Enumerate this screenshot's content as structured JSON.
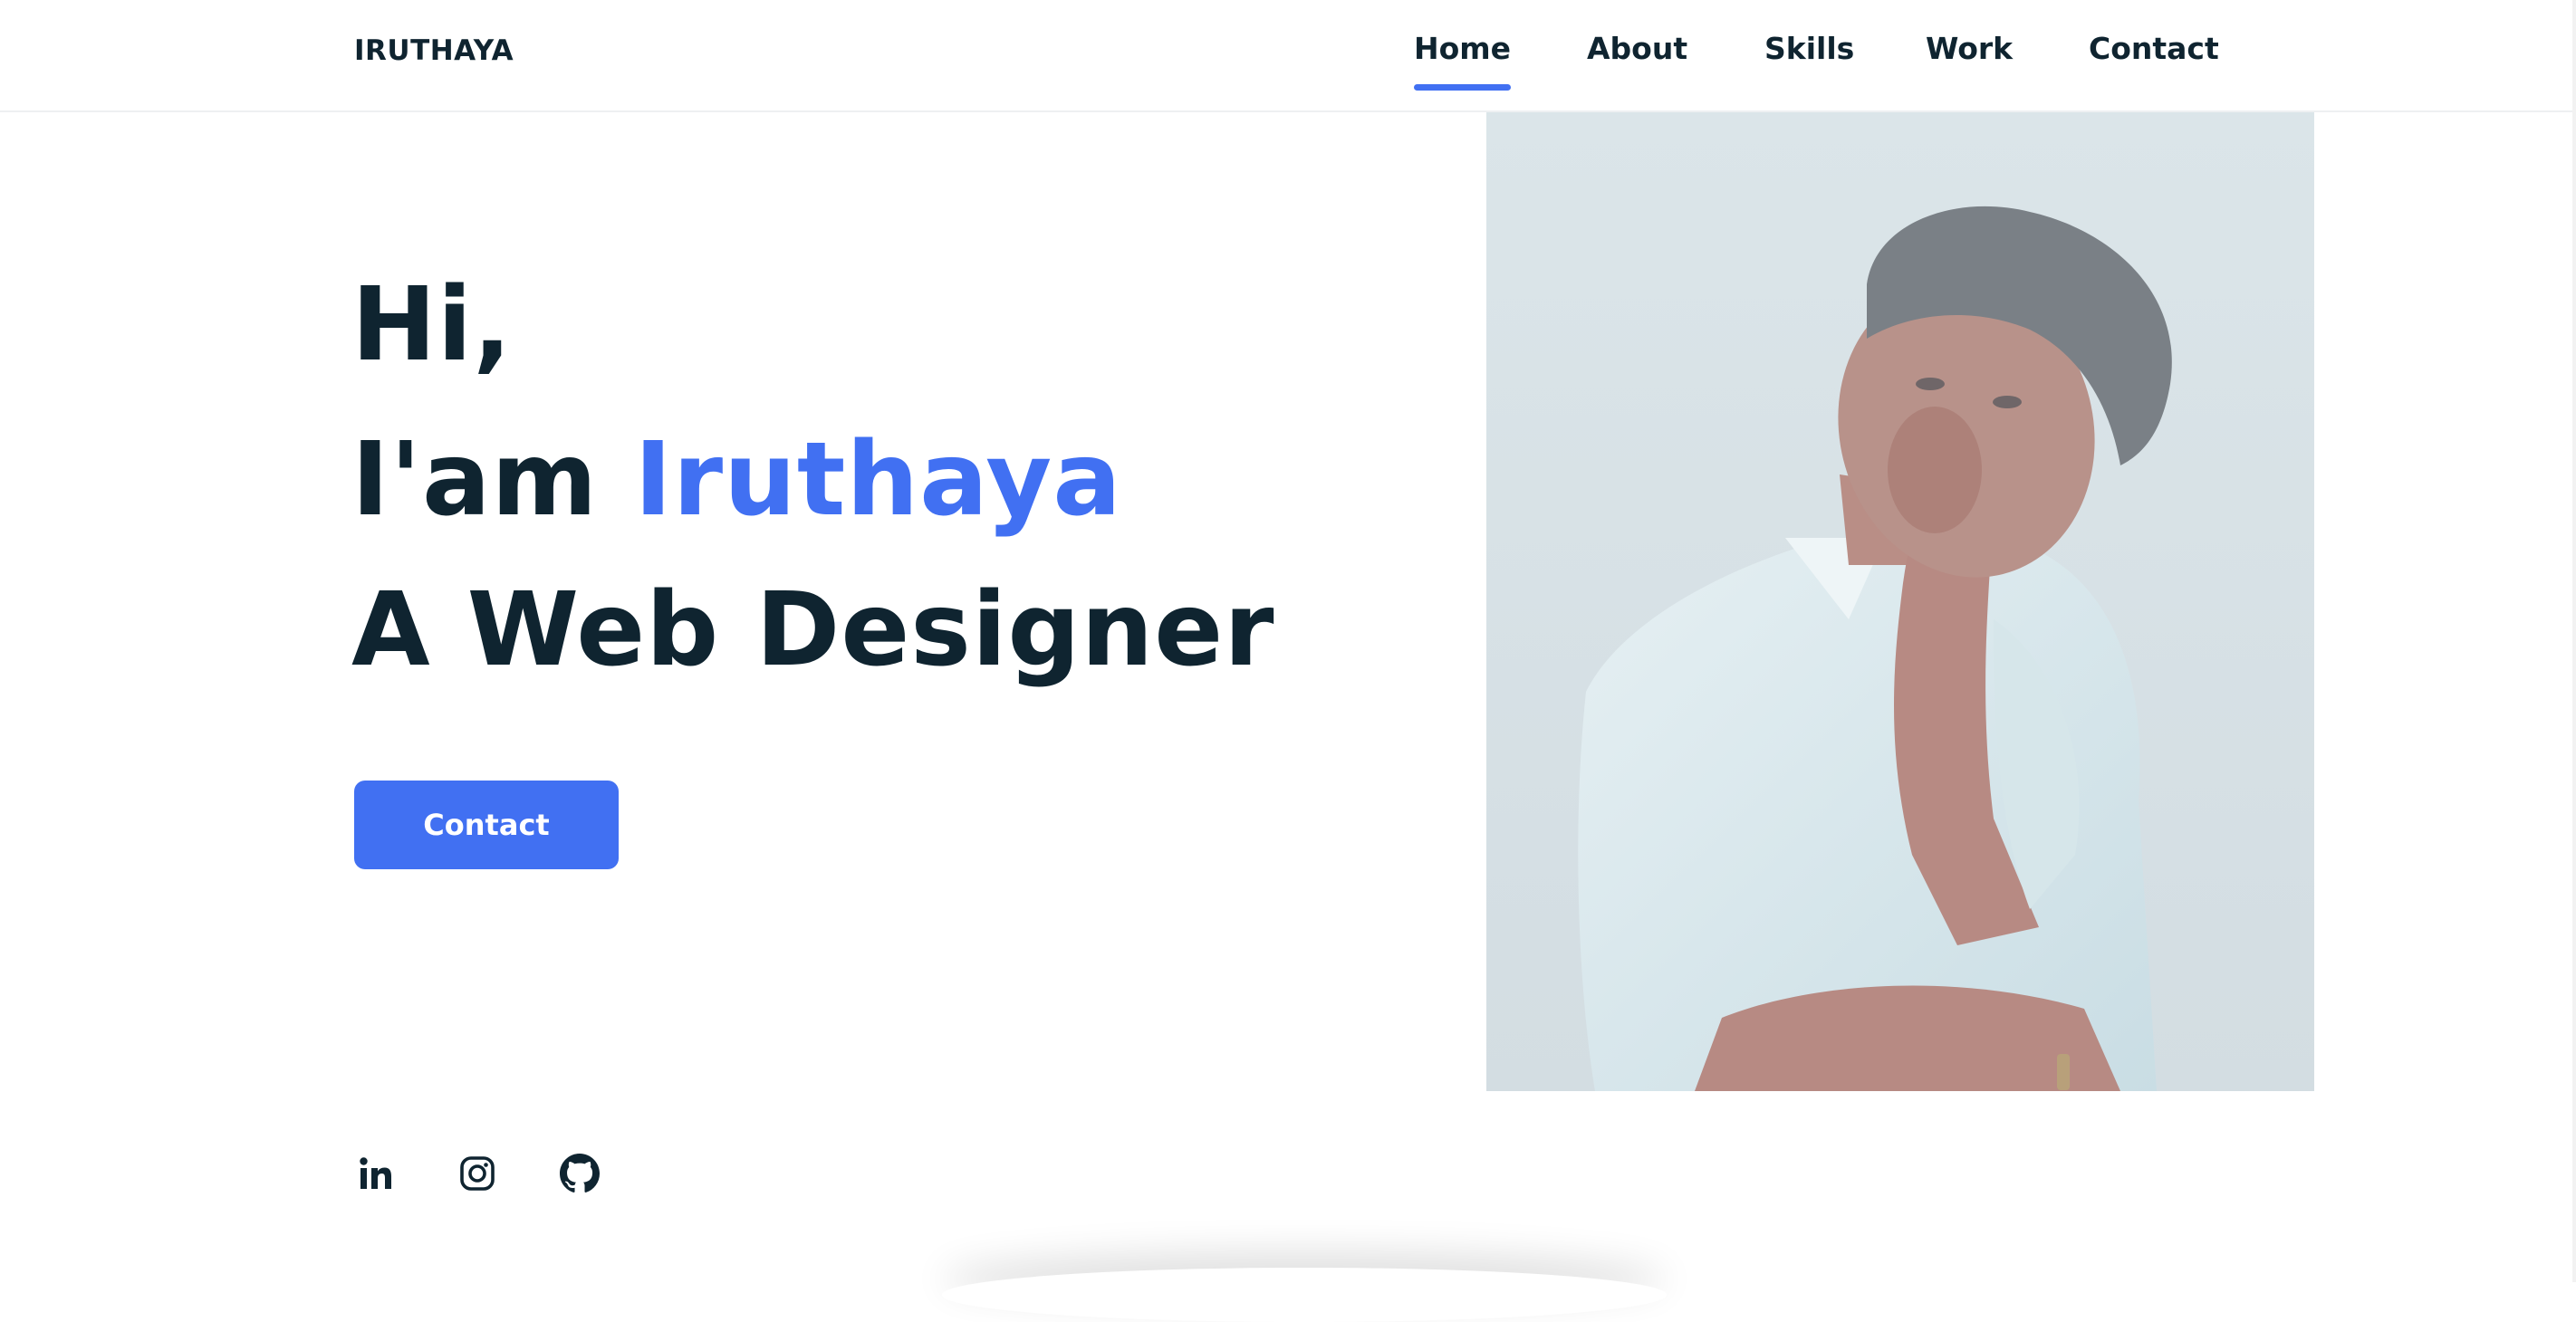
{
  "header": {
    "logo": "IRUTHAYA",
    "nav": [
      {
        "label": "Home",
        "active": true
      },
      {
        "label": "About",
        "active": false
      },
      {
        "label": "Skills",
        "active": false
      },
      {
        "label": "Work",
        "active": false
      },
      {
        "label": "Contact",
        "active": false
      }
    ]
  },
  "hero": {
    "line1": "Hi,",
    "line2_prefix": "I'am ",
    "line2_name": "Iruthaya",
    "line3": "A Web Designer",
    "button_label": "Contact"
  },
  "social": [
    {
      "icon": "linkedin-icon",
      "label": "in"
    },
    {
      "icon": "instagram-icon"
    },
    {
      "icon": "github-icon"
    }
  ],
  "colors": {
    "accent": "#4170f2",
    "text": "#0f2430",
    "background": "#ffffff"
  }
}
